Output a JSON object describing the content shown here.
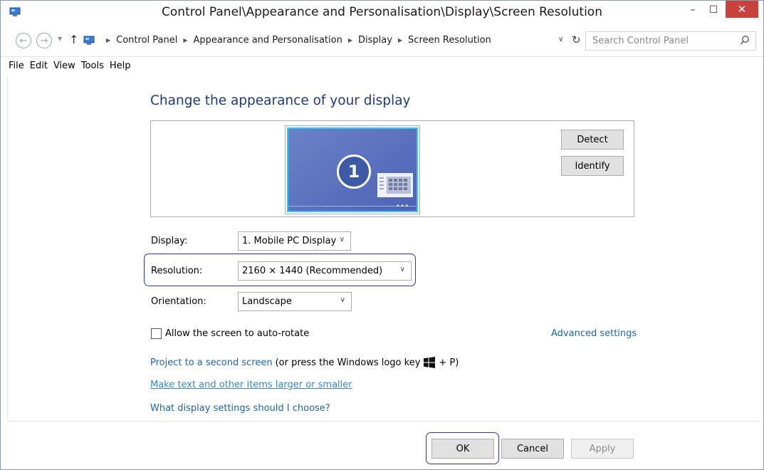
{
  "window": {
    "title": "Control Panel\\Appearance and Personalisation\\Display\\Screen Resolution",
    "controls": {
      "minimize": "–",
      "maximize": "☐",
      "close": "✕"
    }
  },
  "address": {
    "breadcrumbs": [
      "Control Panel",
      "Appearance and Personalisation",
      "Display",
      "Screen Resolution"
    ],
    "search_placeholder": "Search Control Panel"
  },
  "menu": [
    "File",
    "Edit",
    "View",
    "Tools",
    "Help"
  ],
  "main": {
    "heading": "Change the appearance of your display",
    "monitor_number": "1",
    "detect_label": "Detect",
    "identify_label": "Identify",
    "display_label": "Display:",
    "display_value": "1. Mobile PC Display",
    "resolution_label": "Resolution:",
    "resolution_value": "2160 × 1440 (Recommended)",
    "orientation_label": "Orientation:",
    "orientation_value": "Landscape",
    "auto_rotate_label": "Allow the screen to auto-rotate",
    "auto_rotate_checked": false,
    "advanced_link": "Advanced settings",
    "project_link": "Project to a second screen",
    "project_suffix_before": "(or press the Windows logo key",
    "project_suffix_after": "+ P)",
    "text_size_link": "Make text and other items larger or smaller",
    "help_link": "What display settings should I choose?"
  },
  "footer": {
    "ok": "OK",
    "cancel": "Cancel",
    "apply": "Apply"
  },
  "colors": {
    "heading": "#1e3a87",
    "link": "#1e64b4",
    "highlight": "#2e3a9c",
    "close": "#c9413d"
  }
}
